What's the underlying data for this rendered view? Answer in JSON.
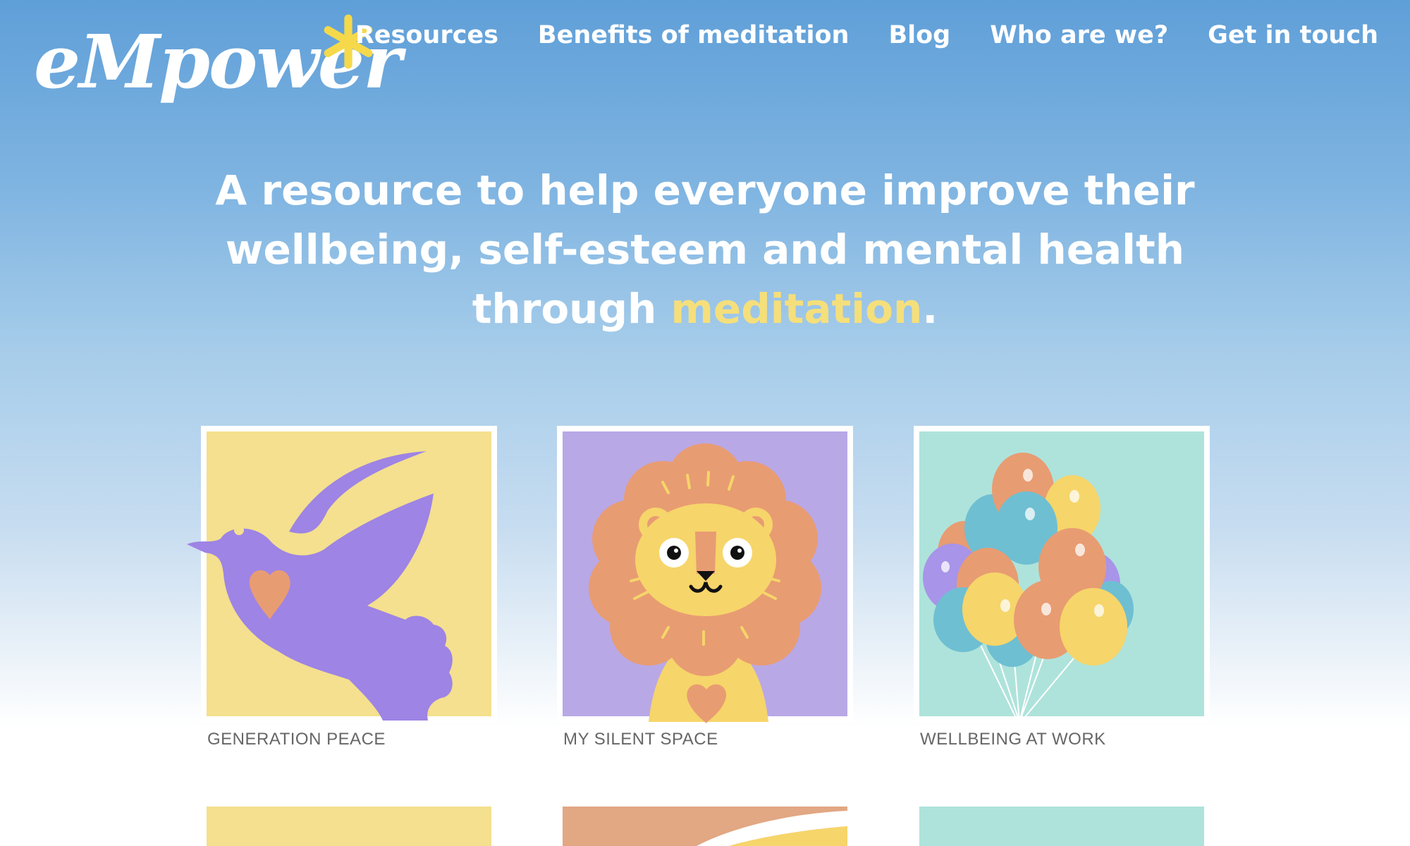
{
  "header": {
    "logo_text": "eMpower",
    "logo_mark_icon": "asterisk-icon",
    "nav": [
      {
        "label": "Resources"
      },
      {
        "label": "Benefits of meditation"
      },
      {
        "label": "Blog"
      },
      {
        "label": "Who are we?"
      },
      {
        "label": "Get in touch"
      }
    ]
  },
  "hero": {
    "line1": "A resource to help everyone improve their",
    "line2": "wellbeing, self-esteem and mental health",
    "line3_prefix": "through ",
    "line3_accent": "meditation",
    "line3_suffix": "."
  },
  "cards": [
    {
      "caption": "GENERATION PEACE",
      "image": "dove-with-heart-illustration"
    },
    {
      "caption": "MY SILENT SPACE",
      "image": "lion-with-heart-illustration"
    },
    {
      "caption": "WELLBEING AT WORK",
      "image": "balloons-illustration"
    }
  ],
  "colors": {
    "accent": "#f5df7b",
    "yellow_card": "#f4e08e",
    "purple_card": "#b9a8e6",
    "mint_card": "#aee3db",
    "text_white": "#ffffff"
  }
}
